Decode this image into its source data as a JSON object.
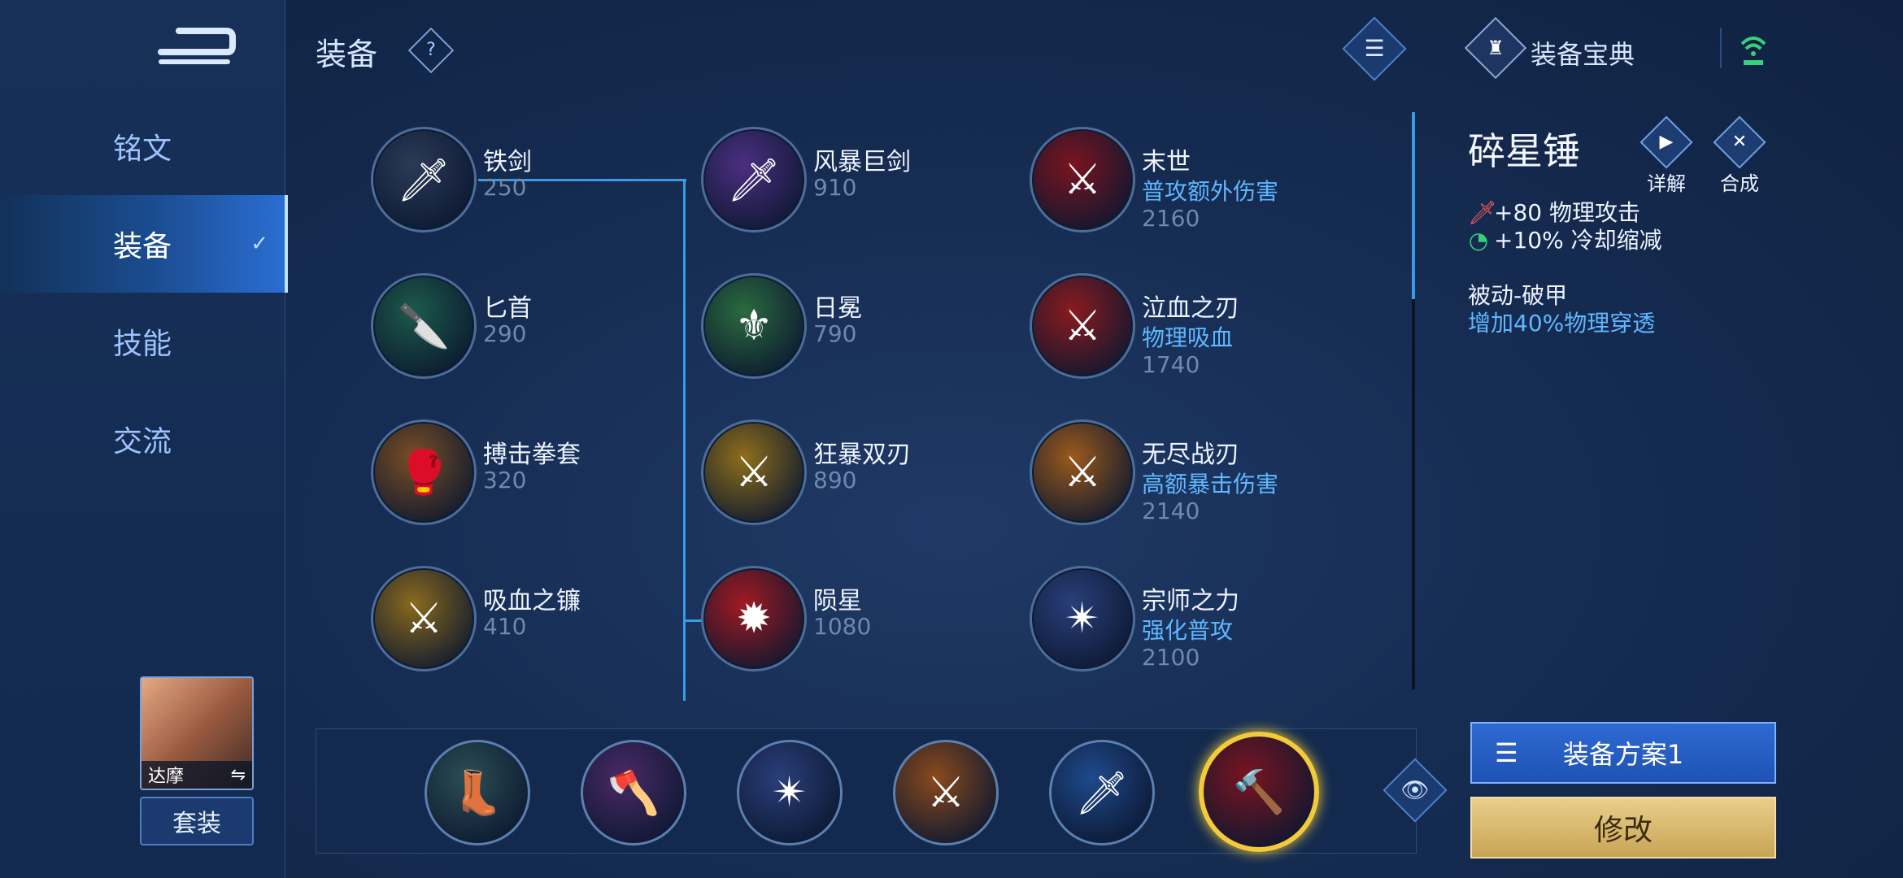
{
  "header": {
    "title": "装备",
    "help_icon": "?",
    "menu_icon": "☰",
    "codex_label": "装备宝典",
    "codex_icon": "♜"
  },
  "sidebar": {
    "back_icon": "back-arrow-icon",
    "items": [
      {
        "label": "铭文",
        "active": false
      },
      {
        "label": "装备",
        "active": true
      },
      {
        "label": "技能",
        "active": false
      },
      {
        "label": "交流",
        "active": false
      }
    ],
    "hero_name": "达摩",
    "swap_icon": "⇋",
    "suit_button": "套装"
  },
  "items": [
    {
      "name": "铁剑",
      "price": "250",
      "desc": "",
      "glyph": "🗡",
      "color": "#2b3a57"
    },
    {
      "name": "匕首",
      "price": "290",
      "desc": "",
      "glyph": "🔪",
      "color": "#1c5a4a"
    },
    {
      "name": "搏击拳套",
      "price": "320",
      "desc": "",
      "glyph": "🥊",
      "color": "#7a4e25"
    },
    {
      "name": "吸血之镰",
      "price": "410",
      "desc": "",
      "glyph": "⚔",
      "color": "#8a6a1d"
    },
    {
      "name": "风暴巨剑",
      "price": "910",
      "desc": "",
      "glyph": "🗡",
      "color": "#4c2f82"
    },
    {
      "name": "日冕",
      "price": "790",
      "desc": "",
      "glyph": "⚜",
      "color": "#2b6a3f"
    },
    {
      "name": "狂暴双刃",
      "price": "890",
      "desc": "",
      "glyph": "⚔",
      "color": "#8e6e1a"
    },
    {
      "name": "陨星",
      "price": "1080",
      "desc": "",
      "glyph": "✹",
      "color": "#a11a22"
    },
    {
      "name": "末世",
      "price": "2160",
      "desc": "普攻额外伤害",
      "glyph": "⚔",
      "color": "#7a1420"
    },
    {
      "name": "泣血之刃",
      "price": "1740",
      "desc": "物理吸血",
      "glyph": "⚔",
      "color": "#8a1b1f"
    },
    {
      "name": "无尽战刃",
      "price": "2140",
      "desc": "高额暴击伤害",
      "glyph": "⚔",
      "color": "#9a5a1c"
    },
    {
      "name": "宗师之力",
      "price": "2100",
      "desc": "强化普攻",
      "glyph": "✴",
      "color": "#2a3f7a"
    }
  ],
  "build": {
    "slots": [
      {
        "glyph": "👢",
        "color": "#2c4f54",
        "selected": false
      },
      {
        "glyph": "🪓",
        "color": "#4a2a66",
        "selected": false
      },
      {
        "glyph": "✴",
        "color": "#2a3f7a",
        "selected": false
      },
      {
        "glyph": "⚔",
        "color": "#8a4a1c",
        "selected": false
      },
      {
        "glyph": "🗡",
        "color": "#1f4a8c",
        "selected": false
      },
      {
        "glyph": "🔨",
        "color": "#7a1420",
        "selected": true
      }
    ],
    "eye_icon": "👁"
  },
  "detail": {
    "title": "碎星锤",
    "details_label": "详解",
    "details_icon": "▶",
    "compose_label": "合成",
    "compose_icon": "✕",
    "stats": [
      {
        "icon": "🗡",
        "text": "+80 物理攻击",
        "color": "#ff5e5e"
      },
      {
        "icon": "◔",
        "text": "+10% 冷却缩减",
        "color": "#34d07a"
      }
    ],
    "passive_name": "被动-破甲",
    "passive_desc": "增加40%物理穿透"
  },
  "buttons": {
    "plan_label": "装备方案1",
    "plan_icon": "☰",
    "modify_label": "修改"
  }
}
